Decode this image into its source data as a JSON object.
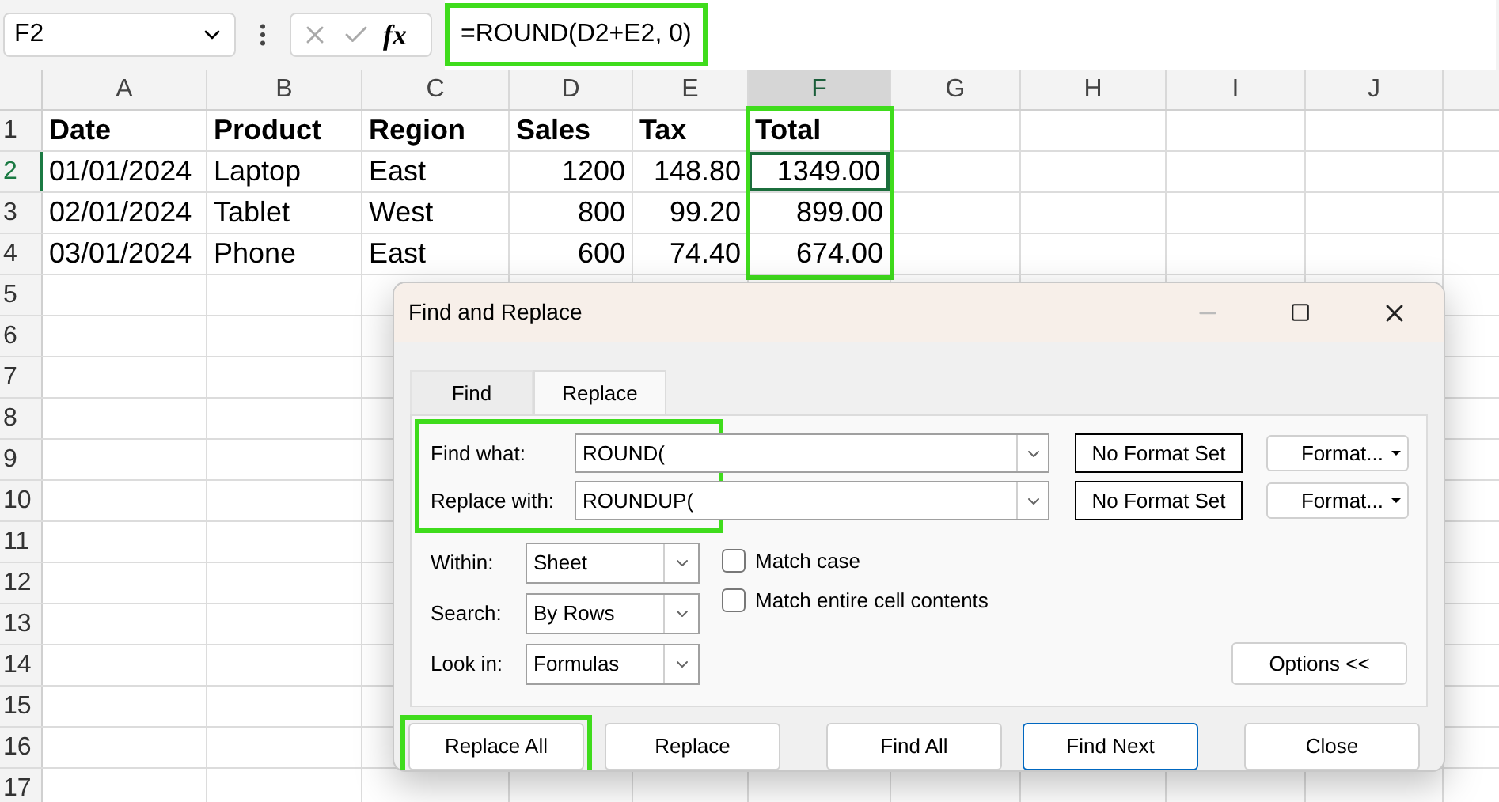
{
  "formula_bar": {
    "name_box": "F2",
    "function_label": "fx",
    "formula": "=ROUND(D2+E2, 0)",
    "highlighted": true
  },
  "sheet": {
    "columns": [
      {
        "letter": "A",
        "selected": false,
        "highlighted": false
      },
      {
        "letter": "B",
        "selected": false,
        "highlighted": false
      },
      {
        "letter": "C",
        "selected": false,
        "highlighted": false
      },
      {
        "letter": "D",
        "selected": false,
        "highlighted": false
      },
      {
        "letter": "E",
        "selected": false,
        "highlighted": false
      },
      {
        "letter": "F",
        "selected": true,
        "highlighted": true
      },
      {
        "letter": "G",
        "selected": false,
        "highlighted": false
      },
      {
        "letter": "H",
        "selected": false,
        "highlighted": false
      },
      {
        "letter": "I",
        "selected": false,
        "highlighted": false
      },
      {
        "letter": "J",
        "selected": false,
        "highlighted": false
      }
    ],
    "rows": [
      {
        "number": "1",
        "kind": "header",
        "selected": false,
        "cells": [
          {
            "text": "Date",
            "selected": false
          },
          {
            "text": "Product",
            "selected": false
          },
          {
            "text": "Region",
            "selected": false
          },
          {
            "text": "Sales",
            "selected": false
          },
          {
            "text": "Tax",
            "selected": false
          },
          {
            "text": "Total",
            "selected": false
          }
        ]
      },
      {
        "number": "2",
        "kind": "data",
        "selected": true,
        "cells": [
          {
            "text": "01/01/2024",
            "selected": false
          },
          {
            "text": "Laptop",
            "selected": false
          },
          {
            "text": "East",
            "selected": false
          },
          {
            "text": "1200",
            "selected": false
          },
          {
            "text": "148.80",
            "selected": false
          },
          {
            "text": "1349.00",
            "selected": true
          }
        ]
      },
      {
        "number": "3",
        "kind": "data",
        "selected": false,
        "cells": [
          {
            "text": "02/01/2024",
            "selected": false
          },
          {
            "text": "Tablet",
            "selected": false
          },
          {
            "text": "West",
            "selected": false
          },
          {
            "text": "800",
            "selected": false
          },
          {
            "text": "99.20",
            "selected": false
          },
          {
            "text": "899.00",
            "selected": false
          }
        ]
      },
      {
        "number": "4",
        "kind": "data",
        "selected": false,
        "cells": [
          {
            "text": "03/01/2024",
            "selected": false
          },
          {
            "text": "Phone",
            "selected": false
          },
          {
            "text": "East",
            "selected": false
          },
          {
            "text": "600",
            "selected": false
          },
          {
            "text": "74.40",
            "selected": false
          },
          {
            "text": "674.00",
            "selected": false
          }
        ]
      },
      {
        "number": "5"
      },
      {
        "number": "6"
      },
      {
        "number": "7"
      },
      {
        "number": "8"
      },
      {
        "number": "9"
      },
      {
        "number": "10"
      },
      {
        "number": "11"
      },
      {
        "number": "12"
      },
      {
        "number": "13"
      },
      {
        "number": "14"
      },
      {
        "number": "15"
      },
      {
        "number": "16"
      },
      {
        "number": "17"
      }
    ]
  },
  "dialog": {
    "title": "Find and Replace",
    "tabs": [
      {
        "label": "Find",
        "selected": false
      },
      {
        "label": "Replace",
        "selected": true
      }
    ],
    "fields_highlighted": true,
    "fields": [
      {
        "label": "Find what:",
        "value": "ROUND(",
        "format": "No Format Set",
        "format_button": "Format..."
      },
      {
        "label": "Replace with:",
        "value": "ROUNDUP(",
        "format": "No Format Set",
        "format_button": "Format..."
      }
    ],
    "selects": [
      {
        "label": "Within:",
        "value": "Sheet"
      },
      {
        "label": "Search:",
        "value": "By Rows"
      },
      {
        "label": "Look in:",
        "value": "Formulas"
      }
    ],
    "checkboxes": [
      {
        "label": "Match case",
        "checked": false
      },
      {
        "label": "Match entire cell contents",
        "checked": false
      }
    ],
    "options_button": "Options <<",
    "buttons": [
      {
        "label": "Replace All",
        "default": false,
        "highlighted": true
      },
      {
        "label": "Replace",
        "default": false,
        "highlighted": false
      },
      {
        "label": "Find All",
        "default": false,
        "highlighted": false
      },
      {
        "label": "Find Next",
        "default": true,
        "highlighted": false
      },
      {
        "label": "Close",
        "default": false,
        "highlighted": false
      }
    ]
  }
}
